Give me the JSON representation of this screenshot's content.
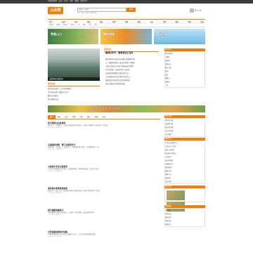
{
  "topbar": {
    "text": "中国旅游网 · 首页 · 登录 · 注册 · 收藏 · 帮助中心"
  },
  "logo": {
    "text": "山水网",
    "sub": "www.shanshui.com"
  },
  "search": {
    "placeholder": "请输入关键词",
    "button": "搜索",
    "hot": "热门：黄山 九寨沟 张家界 丽江"
  },
  "login": {
    "text": "登录 注册"
  },
  "nav": [
    "首页",
    "新闻",
    "景区",
    "线路",
    "酒店",
    "美食",
    "攻略",
    "图库",
    "论坛",
    "专题",
    "摄影",
    "视频",
    "商城"
  ],
  "subnav": [
    "国内游",
    "出境游",
    "周边游",
    "自驾游",
    "户外",
    "摄影",
    "节庆",
    "资讯"
  ],
  "banners": [
    "秀美山川",
    "精彩旅程",
    "蓝天白云"
  ],
  "photo": {
    "caption": "云雾缭绕的山峰风景"
  },
  "news": {
    "title": "旅游资讯",
    "headline": "春游好时节 · 踏青赏花正当时",
    "items": [
      "国内多地景区迎来赏花高峰 游客络绎不绝",
      "五一假期旅游预订火热 热门线路一票难求",
      "古镇文化旅游节开幕 非遗展演吸引游客",
      "自驾游攻略：沿着海岸线一路向南",
      "山地徒步路线推荐 感受自然之美",
      "乡村旅游持续升温 农家乐生意红火",
      "博物馆夜游活动启动 体验别样魅力",
      "高铁开通带动沿线旅游发展"
    ]
  },
  "side1": {
    "title": "热门景点",
    "items": [
      "黄山风景区",
      "九寨沟",
      "张家界",
      "桂林山水",
      "丽江古城",
      "西湖",
      "泰山",
      "峨眉山",
      "武夷山",
      "三亚"
    ]
  },
  "hot": {
    "title": "推荐阅读",
    "items": [
      "春季赏花去哪里 十大赏花胜地推荐",
      "带上相机去旅行 摄影技巧分享",
      "最美古村落盘点",
      "夏日避暑好去处"
    ]
  },
  "strip": {
    "text": "精彩旅程 从这里开始 · 发现身边的美景"
  },
  "tabs": [
    "最新",
    "推荐",
    "热门",
    "攻略",
    "游记",
    "图片",
    "视频",
    "问答"
  ],
  "articles": [
    {
      "title": "春日踏青好去处推荐",
      "body": "春天来了，万物复苏，正是外出踏青赏花的好时节，这里为大家推荐几处景色宜人的去处。",
      "meta": "2016-04-12  阅读(326)"
    },
    {
      "title": "古镇旅游攻略：慢下来感受时光",
      "body": "青石板路、小桥流水，古镇的每一个角落都充满了故事，适合静静地走一走。",
      "meta": "2016-04-11  阅读(218)"
    },
    {
      "title": "山地徒步安全注意事项",
      "body": "户外徒步需要做好充分准备，合理规划路线，携带必要装备，注意天气变化。",
      "meta": "2016-04-10  阅读(189)"
    },
    {
      "title": "海滨城市夏季旅游指南",
      "body": "碧海蓝天，阳光沙滩，海滨城市是夏日度假的首选，美食与美景同样不可错过。",
      "meta": "2016-04-09  阅读(157)"
    },
    {
      "title": "旅行摄影构图技巧",
      "body": "好的构图能让照片更有感染力，掌握几个基本原则，拍出更美的风景。",
      "meta": "2016-04-08  阅读(142)"
    },
    {
      "title": "自驾游路线规划全攻略",
      "body": "合理规划路线与行程，提前了解路况与天气，让自驾之旅更加顺利愉快。",
      "meta": "2016-04-07  阅读(131)"
    }
  ],
  "side2": {
    "title1": "旅游专题",
    "items1": [
      "赏花季专题",
      "古镇游专题",
      "海岛游专题",
      "亲子游专题",
      "户外探险"
    ],
    "title2": "最新游记",
    "items2": [
      "行走在云端的日子",
      "江南水乡三日游",
      "草原上的星空",
      "雪山脚下的村庄",
      "沙漠驼铃",
      "海边的清晨",
      "古城慢生活",
      "峡谷探秘",
      "雨林之旅",
      "湖畔小记",
      "高原骑行",
      "山间小路"
    ],
    "title3": "图片欣赏",
    "title4": "友情链接",
    "items4": [
      "中国旅游",
      "景区导航",
      "酒店预订",
      "机票查询",
      "旅游论坛"
    ]
  }
}
